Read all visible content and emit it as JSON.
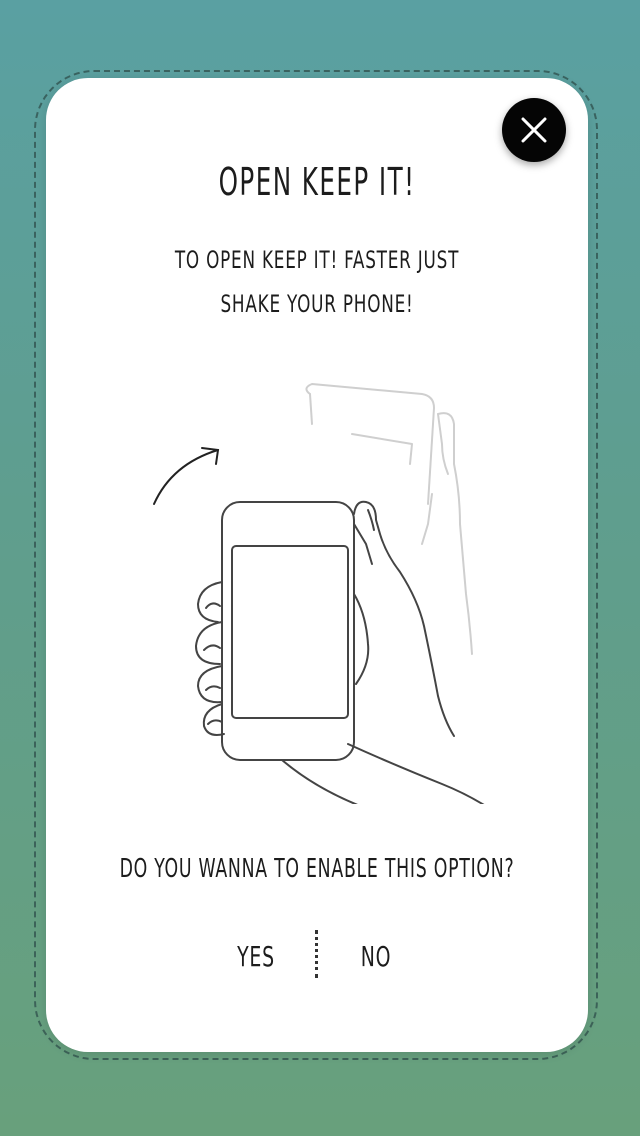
{
  "dialog": {
    "title": "OPEN KEEP IT!",
    "description": "TO OPEN KEEP IT! FASTER JUST SHAKE YOUR PHONE!",
    "question": "DO YOU WANNA TO ENABLE THIS OPTION?",
    "yes_label": "YES",
    "no_label": "NO"
  },
  "icons": {
    "close": "close-icon",
    "illustration": "shake-phone-illustration"
  },
  "colors": {
    "background_top": "#5aa0a2",
    "background_bottom": "#68a07c",
    "card": "#ffffff",
    "close_button": "#050505",
    "text": "#1c1c1c"
  }
}
